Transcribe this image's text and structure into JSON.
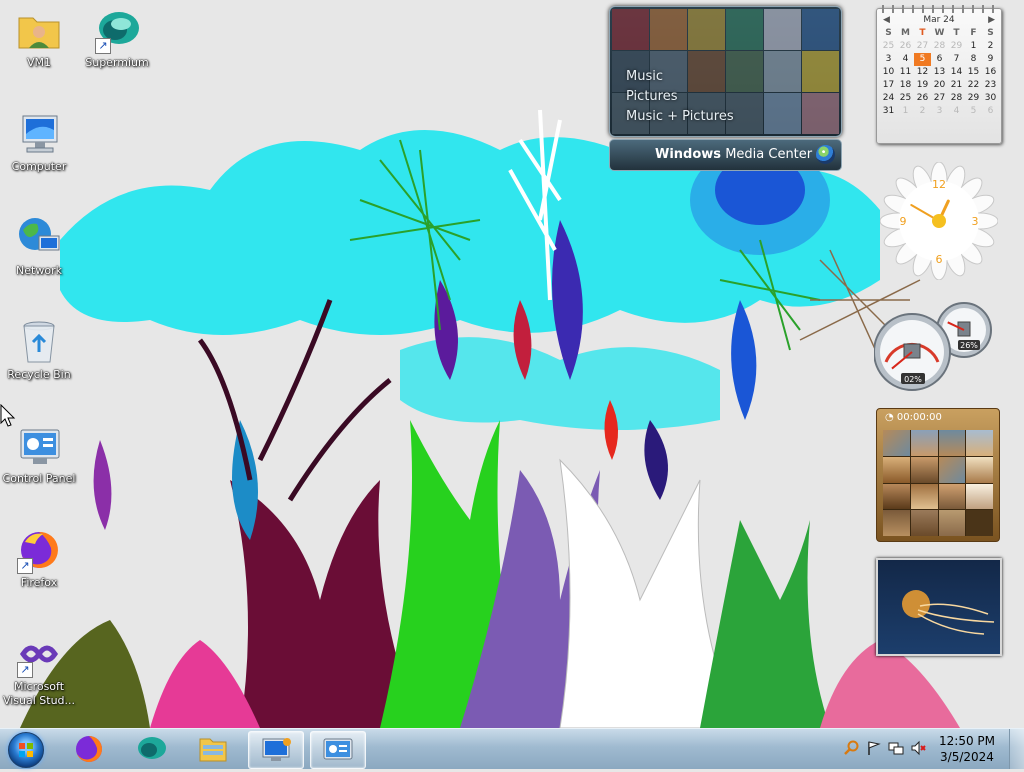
{
  "desktop": {
    "icons": [
      {
        "label": "VM1"
      },
      {
        "label": "Supermium"
      },
      {
        "label": "Computer"
      },
      {
        "label": "Network"
      },
      {
        "label": "Recycle Bin"
      },
      {
        "label": "Control Panel"
      },
      {
        "label": "Firefox"
      },
      {
        "label": "Microsoft Visual Stud..."
      }
    ]
  },
  "media_center": {
    "menu": [
      "Music",
      "Pictures",
      "Music + Pictures"
    ],
    "brand_bold": "Windows",
    "brand_rest": "Media Center"
  },
  "calendar": {
    "month": "Mar 24",
    "weekdays": [
      "S",
      "M",
      "T",
      "W",
      "T",
      "F",
      "S"
    ],
    "days": [
      [
        "25",
        "dim"
      ],
      [
        "26",
        "dim"
      ],
      [
        "27",
        "dim"
      ],
      [
        "28",
        "dim"
      ],
      [
        "29",
        "dim"
      ],
      [
        "1",
        ""
      ],
      [
        "2",
        ""
      ],
      [
        "3",
        ""
      ],
      [
        "4",
        ""
      ],
      [
        "5",
        "today"
      ],
      [
        "6",
        ""
      ],
      [
        "7",
        ""
      ],
      [
        "8",
        ""
      ],
      [
        "9",
        ""
      ],
      [
        "10",
        ""
      ],
      [
        "11",
        ""
      ],
      [
        "12",
        ""
      ],
      [
        "13",
        ""
      ],
      [
        "14",
        ""
      ],
      [
        "15",
        ""
      ],
      [
        "16",
        ""
      ],
      [
        "17",
        ""
      ],
      [
        "18",
        ""
      ],
      [
        "19",
        ""
      ],
      [
        "20",
        ""
      ],
      [
        "21",
        ""
      ],
      [
        "22",
        ""
      ],
      [
        "23",
        ""
      ],
      [
        "24",
        ""
      ],
      [
        "25",
        ""
      ],
      [
        "26",
        ""
      ],
      [
        "27",
        ""
      ],
      [
        "28",
        ""
      ],
      [
        "29",
        ""
      ],
      [
        "30",
        ""
      ],
      [
        "31",
        ""
      ],
      [
        "1",
        "dim"
      ],
      [
        "2",
        "dim"
      ],
      [
        "3",
        "dim"
      ],
      [
        "4",
        "dim"
      ],
      [
        "5",
        "dim"
      ],
      [
        "6",
        "dim"
      ]
    ]
  },
  "clock_gadget": {
    "numerals": [
      "12",
      "3",
      "6",
      "9"
    ],
    "hour": 12,
    "minute": 50
  },
  "cpu_meter": {
    "cpu_percent_label": "02%",
    "memory_percent_label": "26%",
    "cpu_percent": 2,
    "memory_percent": 26
  },
  "puzzle": {
    "timer": "00:00:00"
  },
  "taskbar": {
    "time": "12:50 PM",
    "date": "3/5/2024",
    "pinned": [
      "start",
      "firefox",
      "supermium",
      "explorer",
      "remote-desktop",
      "control-panel"
    ]
  },
  "colors": {
    "taskbar": "#9fbad0",
    "cal_today": "#f07a22",
    "sky_blue": "#31e6ee"
  }
}
